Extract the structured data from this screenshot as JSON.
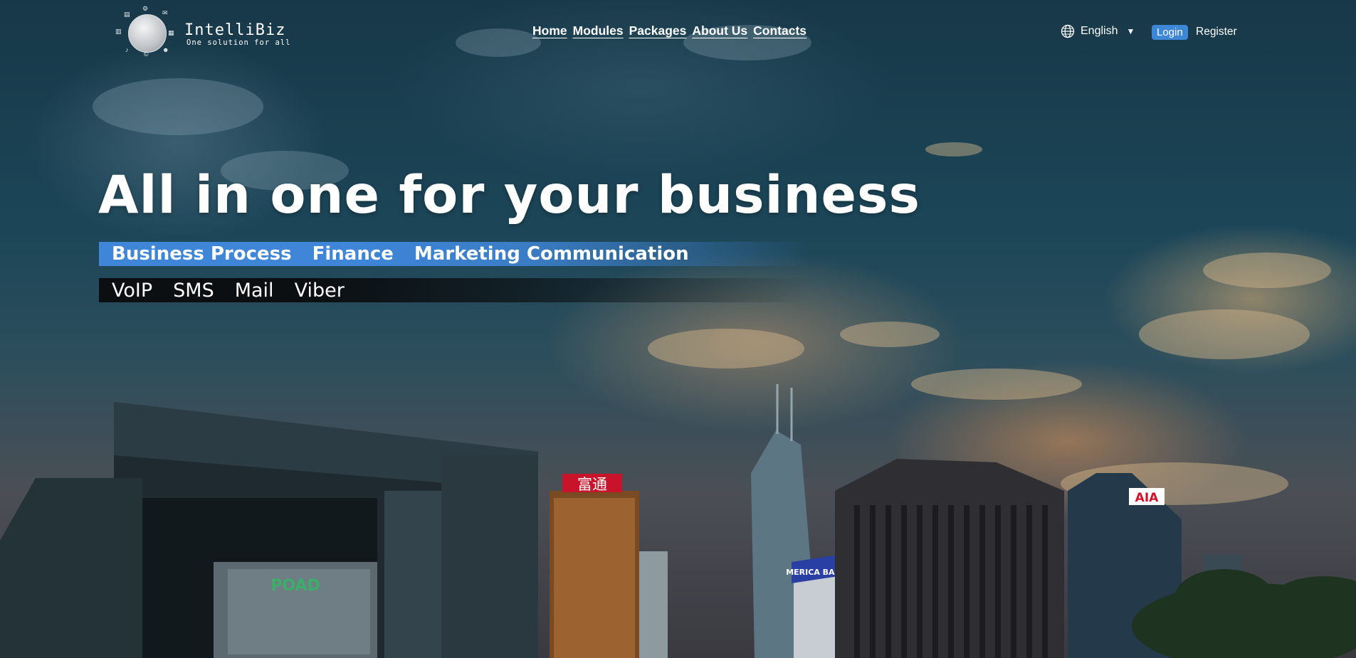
{
  "brand": {
    "name": "IntelliBiz",
    "tagline": "One solution for all"
  },
  "nav": {
    "items": [
      "Home",
      "Modules",
      "Packages",
      "About Us",
      "Contacts"
    ]
  },
  "language": {
    "selected": "English",
    "icon": "globe-icon"
  },
  "auth": {
    "login_label": "Login",
    "register_label": "Register"
  },
  "hero": {
    "title": "All in one for your business",
    "primary_features": [
      "Business Process",
      "Finance",
      "Marketing Communication"
    ],
    "channels": [
      "VoIP",
      "SMS",
      "Mail",
      "Viber"
    ]
  },
  "skyline_signs": {
    "red_sign": "富通",
    "aia_sign": "AIA",
    "poad_sign": "POAD",
    "bank_sign": "MERICA BAN"
  },
  "colors": {
    "accent_blue": "#3f86d9",
    "dark_band": "#0b0f12",
    "sky_top": "#173848"
  }
}
